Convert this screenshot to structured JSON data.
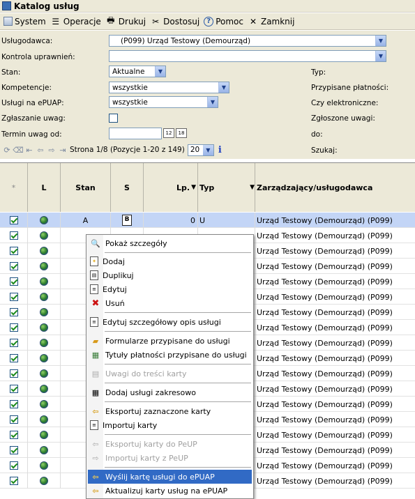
{
  "window": {
    "title": "Katalog usług"
  },
  "toolbar": {
    "items": [
      {
        "label": "System",
        "icon": "system-icon"
      },
      {
        "label": "Operacje",
        "icon": "operations-icon"
      },
      {
        "label": "Drukuj",
        "icon": "print-icon"
      },
      {
        "label": "Dostosuj",
        "icon": "customize-icon"
      },
      {
        "label": "Pomoc",
        "icon": "help-icon"
      },
      {
        "label": "Zamknij",
        "icon": "close-icon"
      }
    ]
  },
  "form": {
    "uslugodawca": {
      "label": "Usługodawca:",
      "value": "(P099) Urząd Testowy (Demourząd)"
    },
    "kontrola": {
      "label": "Kontrola uprawnień:",
      "value": ""
    },
    "stan": {
      "label": "Stan:",
      "value": "Aktualne"
    },
    "kompetencje": {
      "label": "Kompetencje:",
      "value": "wszystkie"
    },
    "epuap": {
      "label": "Usługi na ePUAP:",
      "value": "wszystkie"
    },
    "zglaszanie": {
      "label": "Zgłaszanie uwag:"
    },
    "termin": {
      "label": "Termin uwag od:"
    },
    "right_labels": {
      "typ": "Typ:",
      "platnosci": "Przypisane płatności:",
      "elektroniczne": "Czy elektroniczne:",
      "uwagi": "Zgłoszone uwagi:",
      "do": "do:",
      "szukaj": "Szukaj:"
    },
    "pager": {
      "text": "Strona 1/8 (Pozycje 1-20 z 149)",
      "page_size": "20"
    }
  },
  "grid": {
    "headers": {
      "sel": "*",
      "l": "L",
      "stan": "Stan",
      "s": "S",
      "lp": "Lp.",
      "typ": "Typ",
      "zarzadzajacy": "Zarządzający/usługodawca"
    },
    "first_row": {
      "stan": "A",
      "s": "B",
      "lp": "0",
      "typ": "U"
    },
    "provider": "Urząd Testowy (Demourząd) (P099)",
    "row_count": 18
  },
  "context_menu": {
    "items": [
      {
        "label": "Pokaż szczegóły",
        "icon": "magnifier-icon",
        "disabled": false
      },
      {
        "label": "Dodaj",
        "icon": "add-icon",
        "disabled": false
      },
      {
        "label": "Duplikuj",
        "icon": "duplicate-icon",
        "disabled": false
      },
      {
        "label": "Edytuj",
        "icon": "edit-icon",
        "disabled": false
      },
      {
        "label": "Usuń",
        "icon": "delete-icon",
        "disabled": false
      },
      {
        "label": "Edytuj szczegółowy opis usługi",
        "icon": "document-icon",
        "disabled": false
      },
      {
        "label": "Formularze przypisane do usługi",
        "icon": "forms-icon",
        "disabled": false
      },
      {
        "label": "Tytuły płatności przypisane do usługi",
        "icon": "payments-icon",
        "disabled": false
      },
      {
        "label": "Uwagi do treści karty",
        "icon": "notes-icon",
        "disabled": true
      },
      {
        "label": "Dodaj usługi zakresowo",
        "icon": "table-icon",
        "disabled": false
      },
      {
        "label": "Eksportuj zaznaczone karty",
        "icon": "export-icon",
        "disabled": false
      },
      {
        "label": "Importuj karty",
        "icon": "import-icon",
        "disabled": false
      },
      {
        "label": "Eksportuj karty do PeUP",
        "icon": "export-peup-icon",
        "disabled": true
      },
      {
        "label": "Importuj karty z PeUP",
        "icon": "import-peup-icon",
        "disabled": true
      },
      {
        "label": "Wyślij kartę usługi do ePUAP",
        "icon": "send-epuap-icon",
        "disabled": false,
        "highlighted": true
      },
      {
        "label": "Aktualizuj karty usług na ePUAP",
        "icon": "update-epuap-icon",
        "disabled": false
      }
    ]
  },
  "colors": {
    "selection": "#316ac5",
    "row_selected": "#c3d5f6",
    "chrome": "#ece9d8"
  }
}
